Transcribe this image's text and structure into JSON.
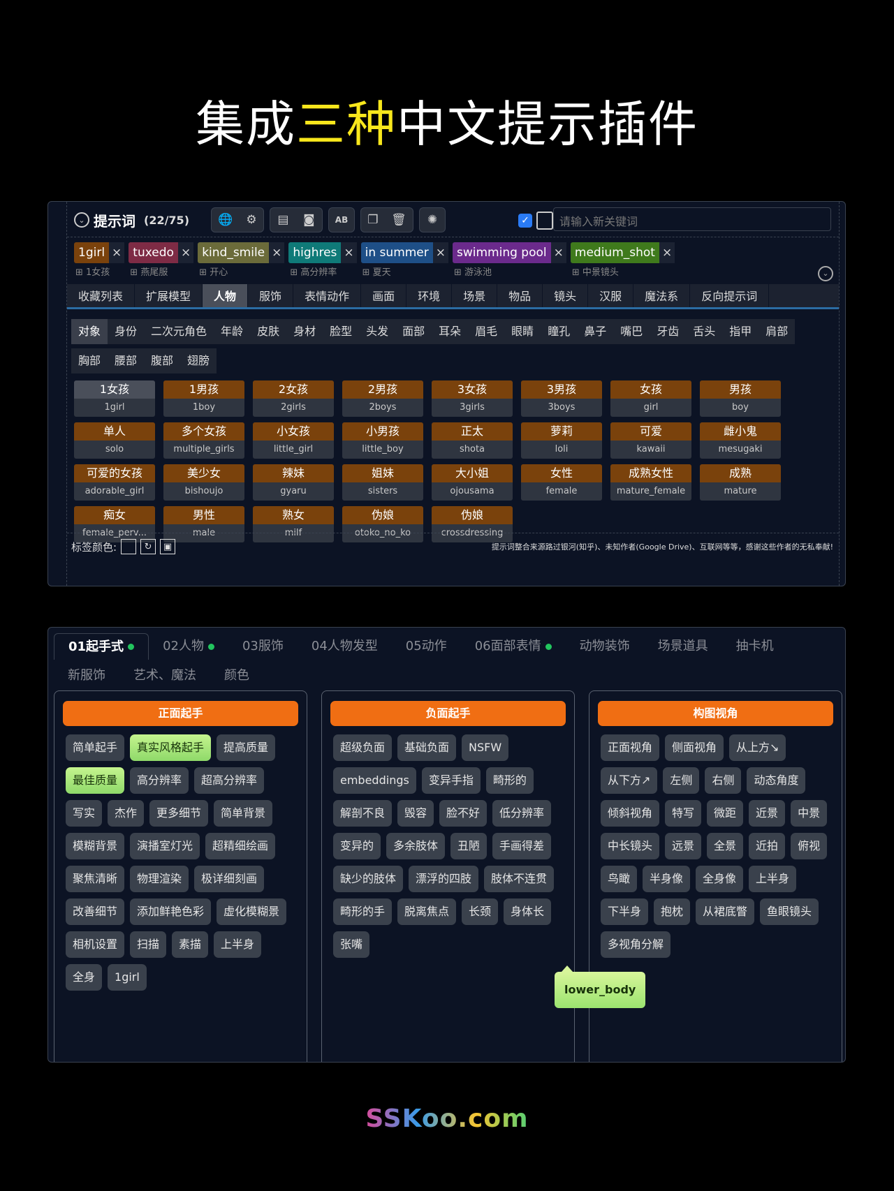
{
  "title": {
    "prefix": "集成",
    "highlight": "三种",
    "suffix": "中文提示插件"
  },
  "panel1": {
    "header": {
      "label": "提示词",
      "count": "(22/75)"
    },
    "search_placeholder": "请输入新关键词",
    "tags": [
      {
        "name": "1girl",
        "sub": "1女孩",
        "color": "#7a420c"
      },
      {
        "name": "tuxedo",
        "sub": "燕尾服",
        "color": "#7e2b45"
      },
      {
        "name": "kind_smile",
        "sub": "开心",
        "color": "#6b6b3a"
      },
      {
        "name": "highres",
        "sub": "高分辨率",
        "color": "#0f7a78"
      },
      {
        "name": "in summer",
        "sub": "夏天",
        "color": "#1e4f87"
      },
      {
        "name": "swimming pool",
        "sub": "游泳池",
        "color": "#6b2a8c"
      },
      {
        "name": "medium_shot",
        "sub": "中景镜头",
        "color": "#3f7a1c"
      }
    ],
    "categories": [
      "收藏列表",
      "扩展模型",
      "人物",
      "服饰",
      "表情动作",
      "画面",
      "环境",
      "场景",
      "物品",
      "镜头",
      "汉服",
      "魔法系",
      "反向提示词"
    ],
    "subcategories": [
      "对象",
      "身份",
      "二次元角色",
      "年龄",
      "皮肤",
      "身材",
      "脸型",
      "头发",
      "面部",
      "耳朵",
      "眉毛",
      "眼睛",
      "瞳孔",
      "鼻子",
      "嘴巴",
      "牙齿",
      "舌头",
      "指甲",
      "肩部",
      "胸部",
      "腰部",
      "腹部",
      "翅膀"
    ],
    "cards": [
      {
        "zh": "1女孩",
        "en": "1girl"
      },
      {
        "zh": "1男孩",
        "en": "1boy"
      },
      {
        "zh": "2女孩",
        "en": "2girls"
      },
      {
        "zh": "2男孩",
        "en": "2boys"
      },
      {
        "zh": "3女孩",
        "en": "3girls"
      },
      {
        "zh": "3男孩",
        "en": "3boys"
      },
      {
        "zh": "女孩",
        "en": "girl"
      },
      {
        "zh": "男孩",
        "en": "boy"
      },
      {
        "zh": "单人",
        "en": "solo"
      },
      {
        "zh": "多个女孩",
        "en": "multiple_girls"
      },
      {
        "zh": "小女孩",
        "en": "little_girl"
      },
      {
        "zh": "小男孩",
        "en": "little_boy"
      },
      {
        "zh": "正太",
        "en": "shota"
      },
      {
        "zh": "萝莉",
        "en": "loli"
      },
      {
        "zh": "可爱",
        "en": "kawaii"
      },
      {
        "zh": "雌小鬼",
        "en": "mesugaki"
      },
      {
        "zh": "可爱的女孩",
        "en": "adorable_girl"
      },
      {
        "zh": "美少女",
        "en": "bishoujo"
      },
      {
        "zh": "辣妹",
        "en": "gyaru"
      },
      {
        "zh": "姐妹",
        "en": "sisters"
      },
      {
        "zh": "大小姐",
        "en": "ojousama"
      },
      {
        "zh": "女性",
        "en": "female"
      },
      {
        "zh": "成熟女性",
        "en": "mature_female"
      },
      {
        "zh": "成熟",
        "en": "mature"
      },
      {
        "zh": "痴女",
        "en": "female_perv..."
      },
      {
        "zh": "男性",
        "en": "male"
      },
      {
        "zh": "熟女",
        "en": "milf"
      },
      {
        "zh": "伪娘",
        "en": "otoko_no_ko"
      },
      {
        "zh": "伪娘",
        "en": "crossdressing"
      }
    ],
    "footer": {
      "label": "标签颜色:",
      "credit": "提示词整合来源路过银河(知乎)、未知作者(Google Drive)、互联网等等，感谢这些作者的无私奉献!"
    }
  },
  "panel2": {
    "tabs": [
      {
        "label": "01起手式",
        "dot": true
      },
      {
        "label": "02人物",
        "dot": true
      },
      {
        "label": "03服饰",
        "dot": false
      },
      {
        "label": "04人物发型",
        "dot": false
      },
      {
        "label": "05动作",
        "dot": false
      },
      {
        "label": "06面部表情",
        "dot": true
      },
      {
        "label": "动物装饰",
        "dot": false
      },
      {
        "label": "场景道具",
        "dot": false
      },
      {
        "label": "抽卡机",
        "dot": false
      },
      {
        "label": "新服饰",
        "dot": false
      },
      {
        "label": "艺术、魔法",
        "dot": false
      },
      {
        "label": "颜色",
        "dot": false
      }
    ],
    "columns": [
      {
        "header": "正面起手",
        "chips": [
          "简单起手",
          "真实风格起手",
          "提高质量",
          "最佳质量",
          "高分辨率",
          "超高分辨率",
          "写实",
          "杰作",
          "更多细节",
          "简单背景",
          "模糊背景",
          "演播室灯光",
          "超精细绘画",
          "聚焦清晰",
          "物理渲染",
          "极详细刻画",
          "改善细节",
          "添加鲜艳色彩",
          "虚化模糊景",
          "相机设置",
          "扫描",
          "素描",
          "上半身",
          "全身",
          "1girl"
        ],
        "green": [
          "真实风格起手",
          "最佳质量"
        ]
      },
      {
        "header": "负面起手",
        "chips": [
          "超级负面",
          "基础负面",
          "NSFW",
          "embeddings",
          "变异手指",
          "畸形的",
          "解剖不良",
          "毁容",
          "脸不好",
          "低分辨率",
          "变异的",
          "多余肢体",
          "丑陋",
          "手画得差",
          "缺少的肢体",
          "漂浮的四肢",
          "肢体不连贯",
          "畸形的手",
          "脱离焦点",
          "长颈",
          "身体长",
          "张嘴"
        ],
        "green": []
      },
      {
        "header": "构图视角",
        "chips": [
          "正面视角",
          "侧面视角",
          "从上方↘",
          "从下方↗",
          "左侧",
          "右侧",
          "动态角度",
          "倾斜视角",
          "特写",
          "微距",
          "近景",
          "中景",
          "中长镜头",
          "远景",
          "全景",
          "近拍",
          "俯视",
          "鸟瞰",
          "半身像",
          "全身像",
          "上半身",
          "下半身",
          "抱枕",
          "从裙底瞥",
          "鱼眼镜头",
          "多视角分解"
        ],
        "green": []
      }
    ],
    "tooltip": "lower_body"
  },
  "logo": "SSKoo.com"
}
